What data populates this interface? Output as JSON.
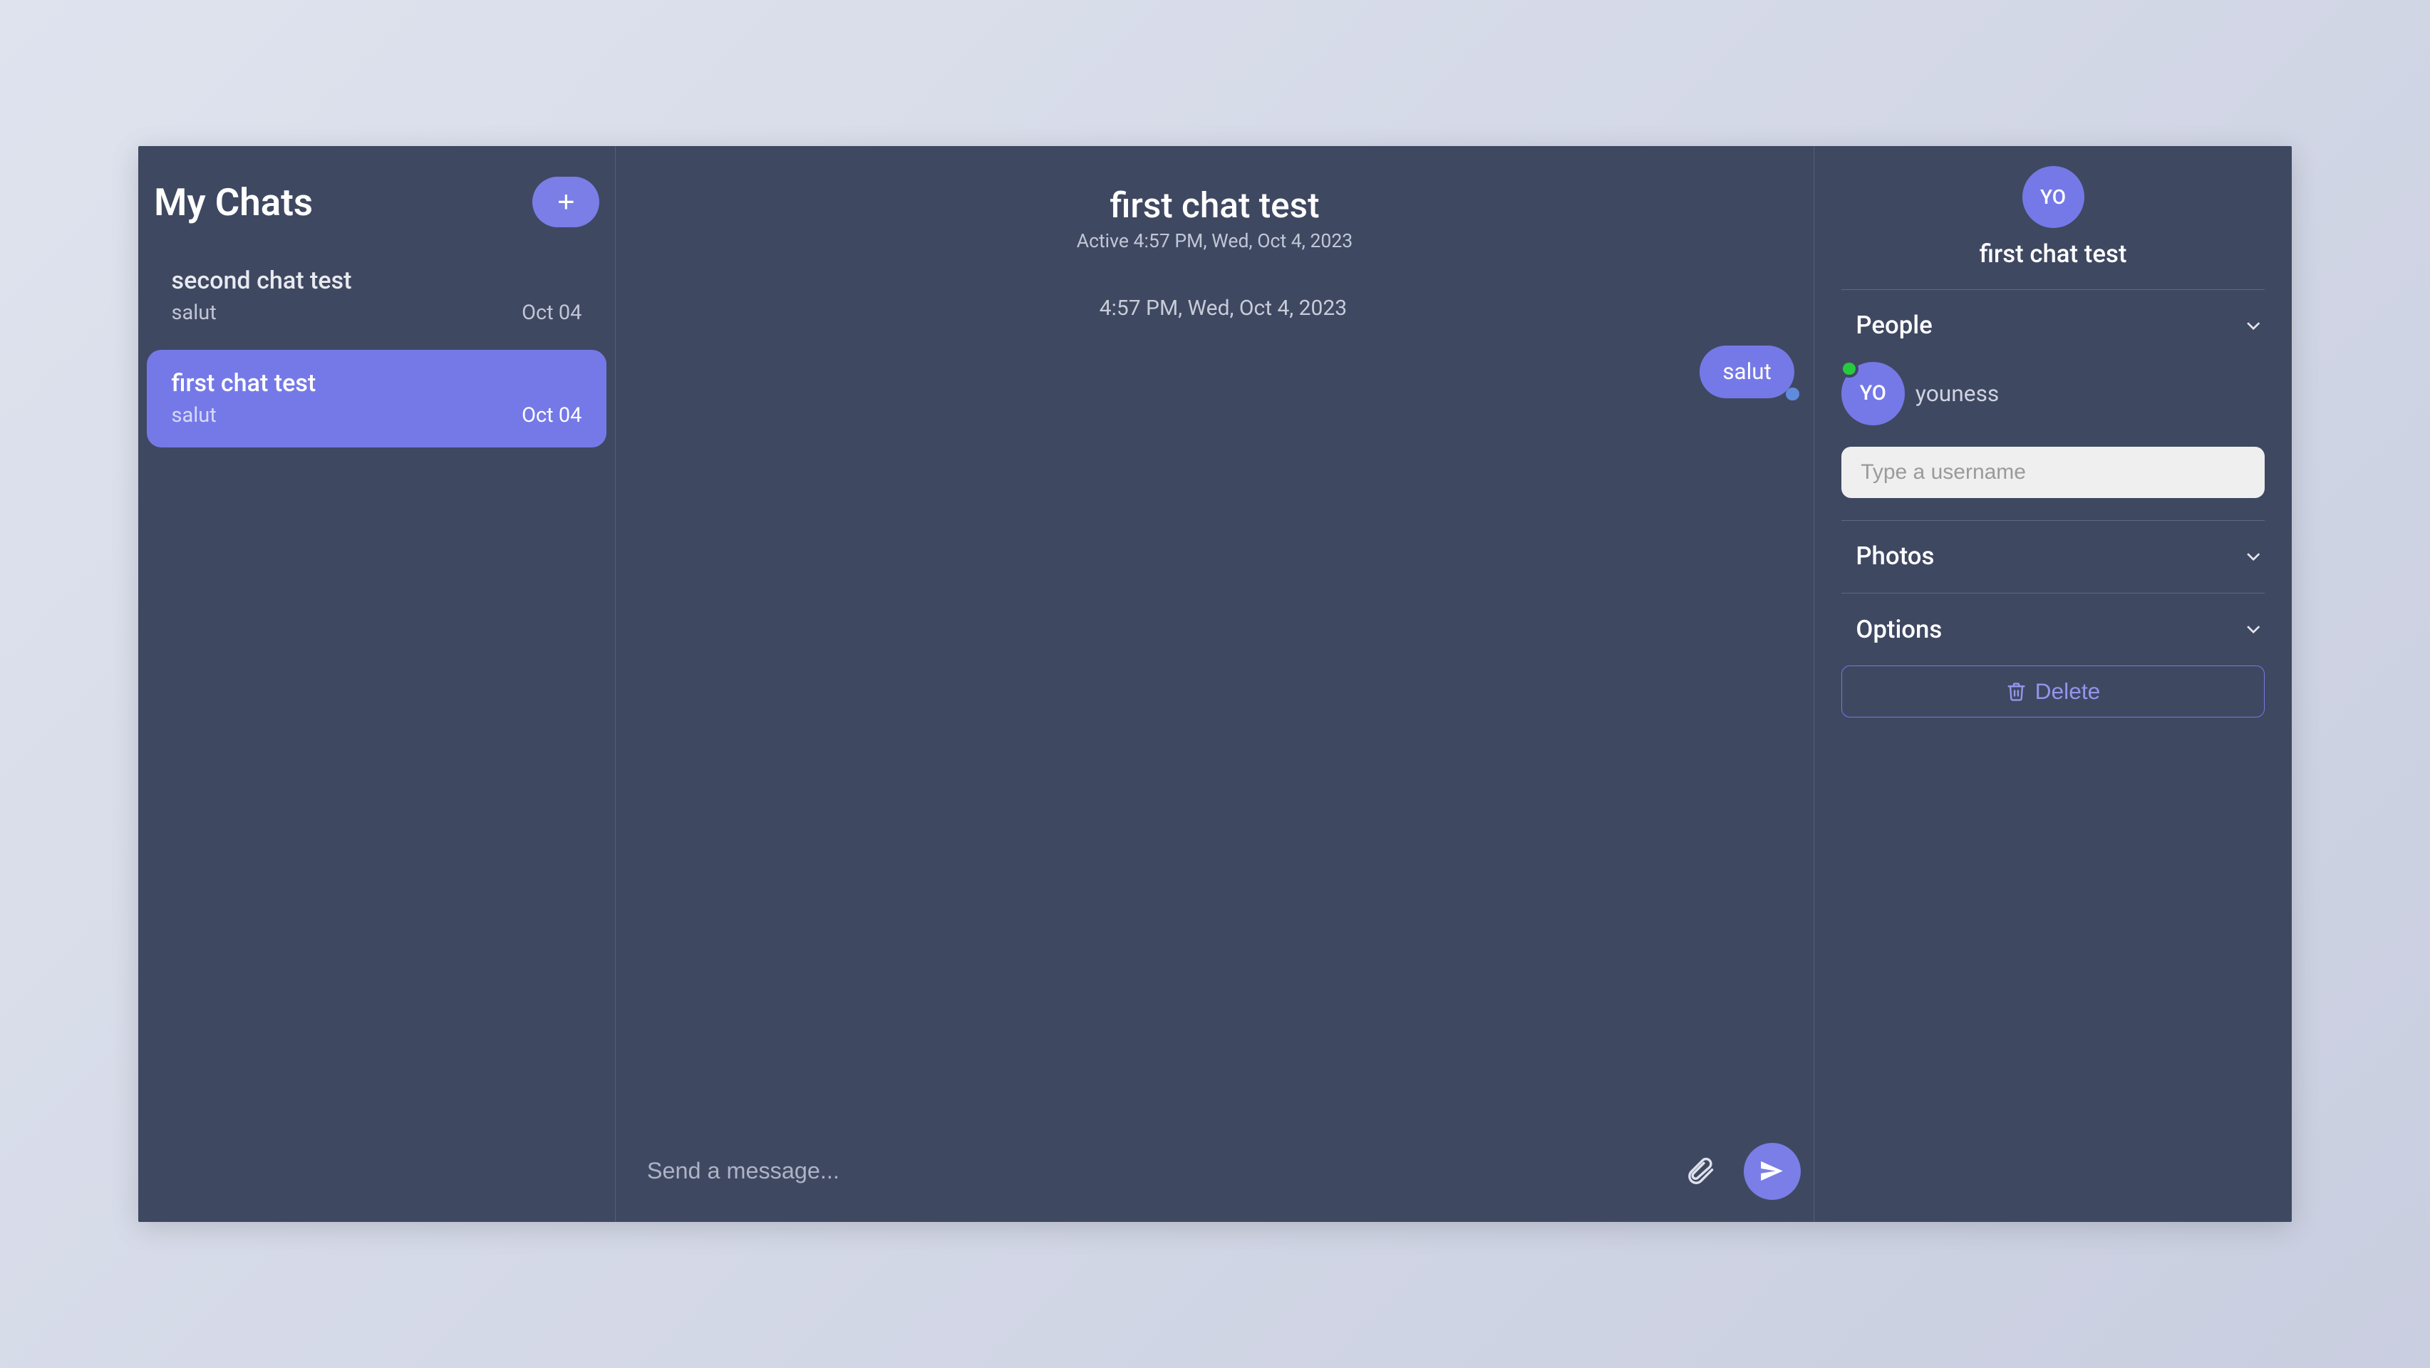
{
  "sidebar": {
    "title": "My Chats",
    "items": [
      {
        "title": "second chat test",
        "snippet": "salut",
        "date": "Oct 04",
        "active": false
      },
      {
        "title": "first chat test",
        "snippet": "salut",
        "date": "Oct 04",
        "active": true
      }
    ]
  },
  "chat": {
    "title": "first chat test",
    "subtitle": "Active 4:57 PM, Wed, Oct 4, 2023",
    "timestamp_line": "4:57 PM, Wed, Oct 4, 2023",
    "messages": [
      {
        "text": "salut",
        "mine": true
      }
    ],
    "composer_placeholder": "Send a message..."
  },
  "details": {
    "avatar_initials": "YO",
    "title": "first chat test",
    "people_label": "People",
    "photos_label": "Photos",
    "options_label": "Options",
    "person": {
      "initials": "YO",
      "name": "youness"
    },
    "username_placeholder": "Type a username",
    "delete_label": "Delete"
  }
}
